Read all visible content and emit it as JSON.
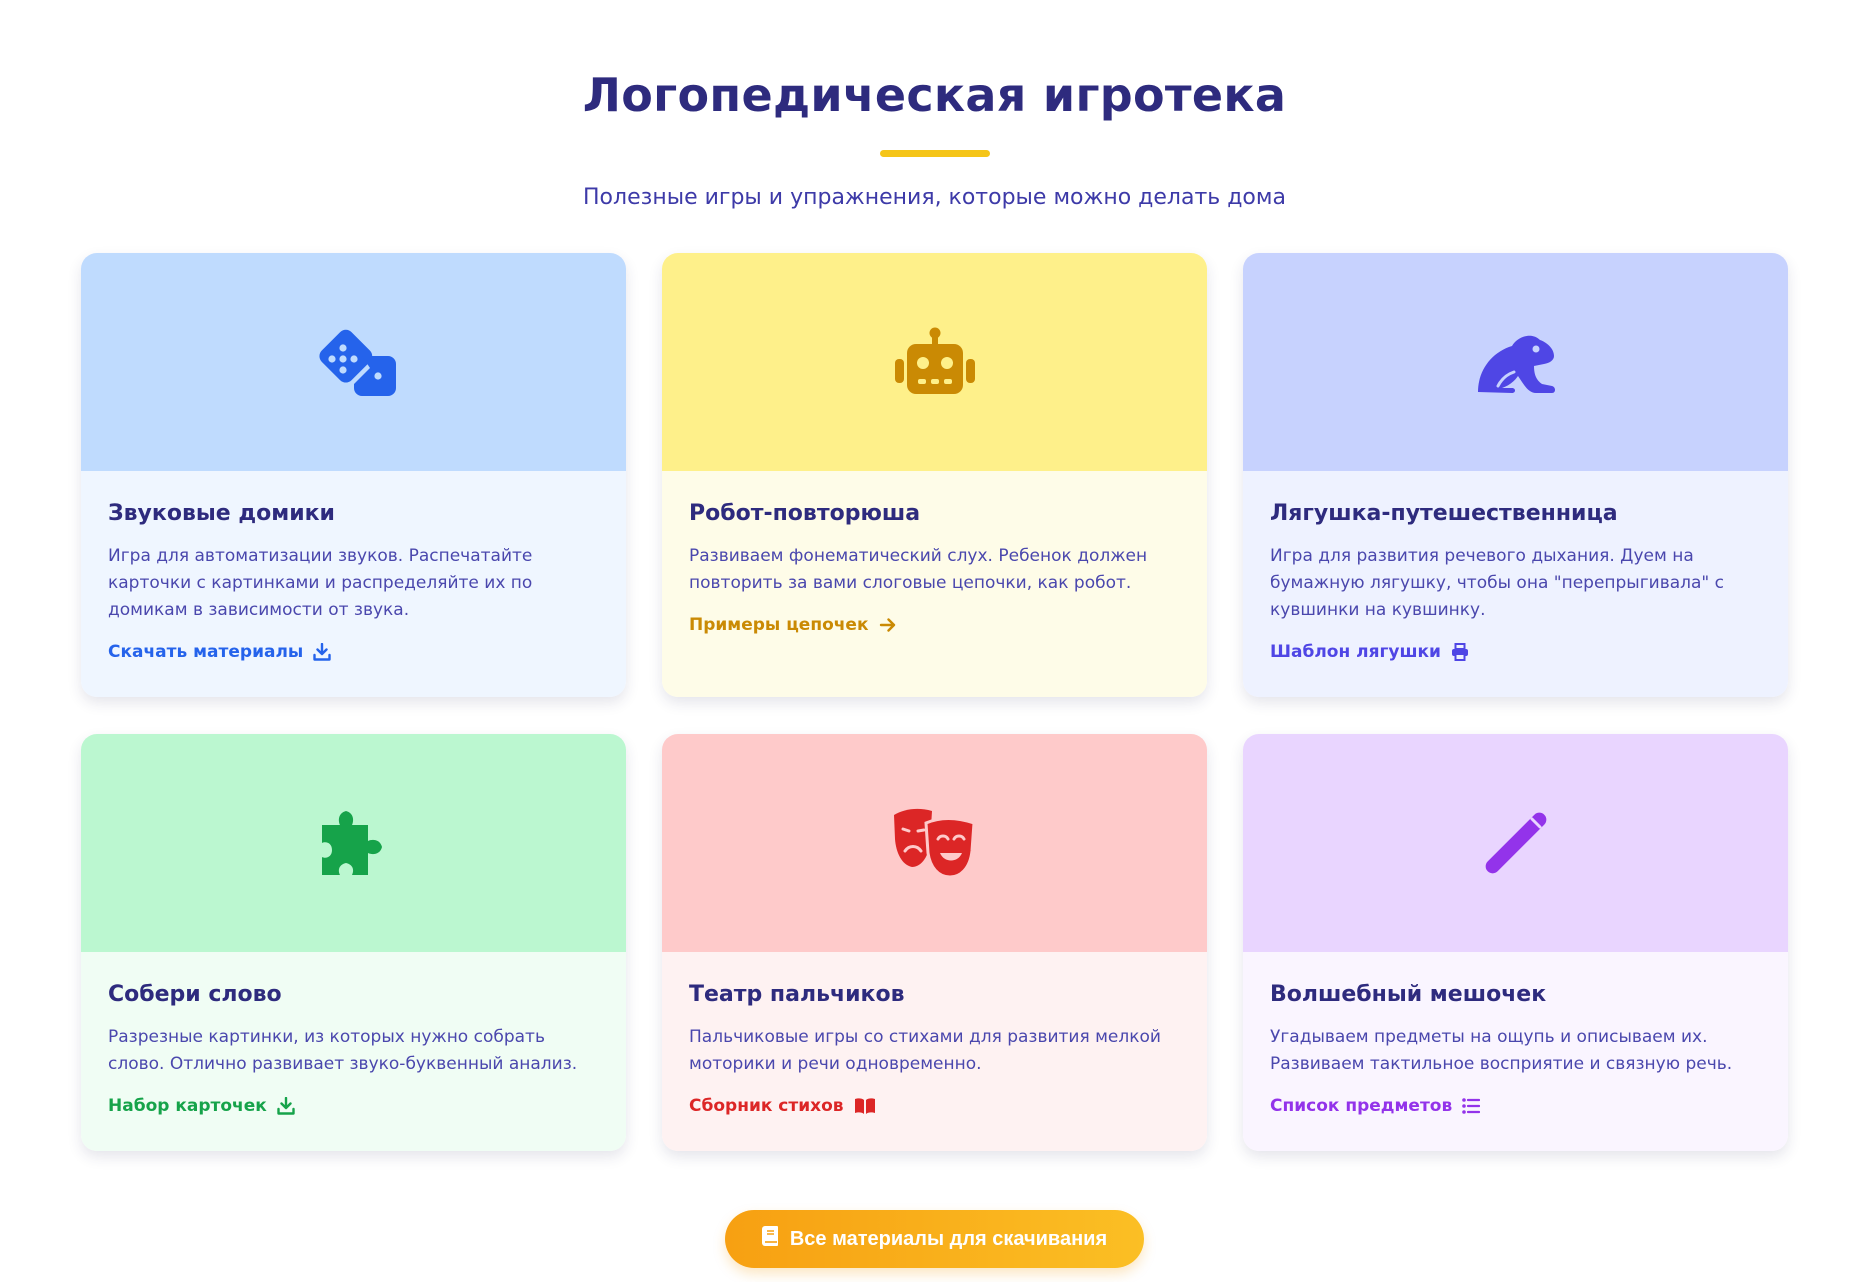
{
  "header": {
    "title": "Логопедическая игротека",
    "subtitle": "Полезные игры и упражнения, которые можно делать дома"
  },
  "cards": [
    {
      "title": "Звуковые домики",
      "description": "Игра для автоматизации звуков. Распечатайте карточки с картинками и распределяйте их по домикам в зависимости от звука.",
      "link_label": "Скачать материалы",
      "icon": "dice-icon",
      "link_icon": "download-icon",
      "top_color": "#bfdbfe",
      "body_color": "#eff6ff",
      "accent": "#2563eb"
    },
    {
      "title": "Робот-повторюша",
      "description": "Развиваем фонематический слух. Ребенок должен повторить за вами слоговые цепочки, как робот.",
      "link_label": "Примеры цепочек",
      "icon": "robot-icon",
      "link_icon": "arrow-right-icon",
      "top_color": "#fef08a",
      "body_color": "#fefce8",
      "accent": "#ca8a04"
    },
    {
      "title": "Лягушка-путешественница",
      "description": "Игра для развития речевого дыхания. Дуем на бумажную лягушку, чтобы она \"перепрыгивала\" с кувшинки на кувшинку.",
      "link_label": "Шаблон лягушки",
      "icon": "frog-icon",
      "link_icon": "print-icon",
      "top_color": "#c7d2fe",
      "body_color": "#eef2ff",
      "accent": "#4f46e5"
    },
    {
      "title": "Собери слово",
      "description": "Разрезные картинки, из которых нужно собрать слово. Отлично развивает звуко-буквенный анализ.",
      "link_label": "Набор карточек",
      "icon": "puzzle-icon",
      "link_icon": "download-icon",
      "top_color": "#bbf7d0",
      "body_color": "#f0fdf4",
      "accent": "#16a34a"
    },
    {
      "title": "Театр пальчиков",
      "description": "Пальчиковые игры со стихами для развития мелкой моторики и речи одновременно.",
      "link_label": "Сборник стихов",
      "icon": "theater-masks-icon",
      "link_icon": "book-open-icon",
      "top_color": "#fecaca",
      "body_color": "#fef2f2",
      "accent": "#dc2626"
    },
    {
      "title": "Волшебный мешочек",
      "description": "Угадываем предметы на ощупь и описываем их. Развиваем тактильное восприятие и связную речь.",
      "link_label": "Список предметов",
      "icon": "magic-wand-icon",
      "link_icon": "list-icon",
      "top_color": "#e9d5ff",
      "body_color": "#faf5ff",
      "accent": "#9333ea"
    }
  ],
  "cta": {
    "label": "Все материалы для скачивания",
    "icon": "book-icon"
  }
}
